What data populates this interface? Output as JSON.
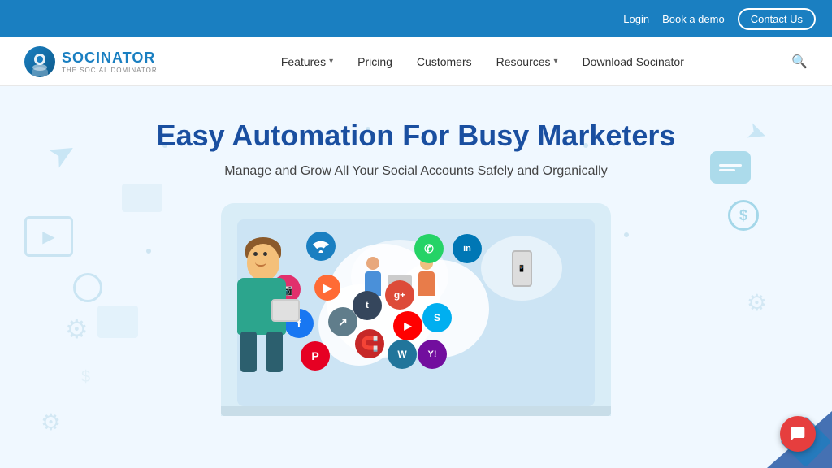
{
  "topbar": {
    "login_label": "Login",
    "book_demo_label": "Book a demo",
    "contact_label": "Contact Us"
  },
  "navbar": {
    "logo_text": "SOCINATOR",
    "logo_subtext": "THE SOCIAL DOMINATOR",
    "features_label": "Features",
    "pricing_label": "Pricing",
    "customers_label": "Customers",
    "resources_label": "Resources",
    "download_label": "Download Socinator"
  },
  "hero": {
    "title": "Easy Automation For Busy Marketers",
    "subtitle": "Manage and Grow All Your Social Accounts Safely and Organically"
  },
  "decorations": {
    "dollar_sign": "$",
    "chat_icon": "💬"
  }
}
